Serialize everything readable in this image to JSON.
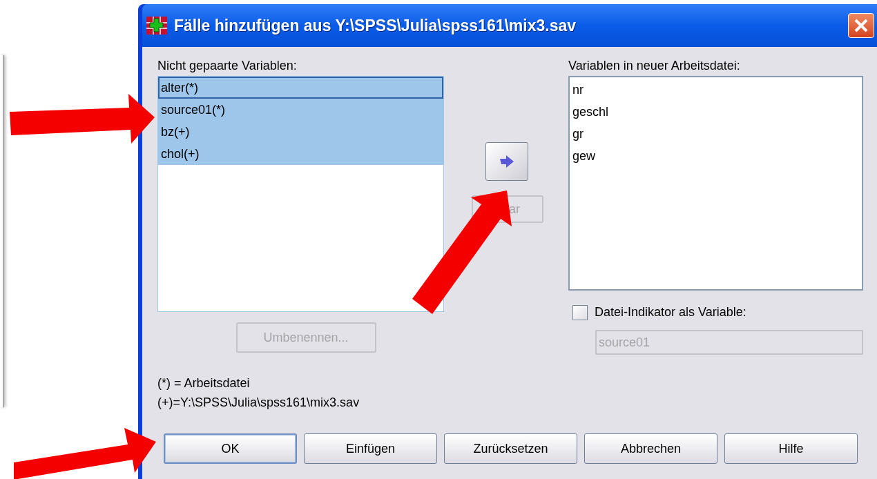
{
  "window": {
    "title": "Fälle hinzufügen aus Y:\\SPSS\\Julia\\spss161\\mix3.sav"
  },
  "unpaired": {
    "label": "Nicht gepaarte Variablen:",
    "items": [
      {
        "text": "alter(*)",
        "selected": true,
        "focused": true
      },
      {
        "text": "source01(*)",
        "selected": true,
        "focused": false
      },
      {
        "text": "bz(+)",
        "selected": true,
        "focused": false
      },
      {
        "text": "chol(+)",
        "selected": true,
        "focused": false
      }
    ]
  },
  "partial_button": {
    "label": "ar",
    "disabled": true
  },
  "rename_button": {
    "label": "Umbenennen...",
    "disabled": true
  },
  "new_file": {
    "label": "Variablen in neuer Arbeitsdatei:",
    "items": [
      {
        "text": "nr",
        "selected": false
      },
      {
        "text": "geschl",
        "selected": false
      },
      {
        "text": "gr",
        "selected": false
      },
      {
        "text": "gew",
        "selected": false
      }
    ]
  },
  "indicator": {
    "label": "Datei-Indikator als Variable:",
    "checked": false,
    "value": "source01",
    "disabled": true
  },
  "legend": [
    "(*) = Arbeitsdatei",
    "(+)=Y:\\SPSS\\Julia\\spss161\\mix3.sav"
  ],
  "buttons": [
    {
      "label": "OK",
      "default": true
    },
    {
      "label": "Einfügen",
      "default": false
    },
    {
      "label": "Zurücksetzen",
      "default": false
    },
    {
      "label": "Abbrechen",
      "default": false
    },
    {
      "label": "Hilfe",
      "default": false
    }
  ]
}
